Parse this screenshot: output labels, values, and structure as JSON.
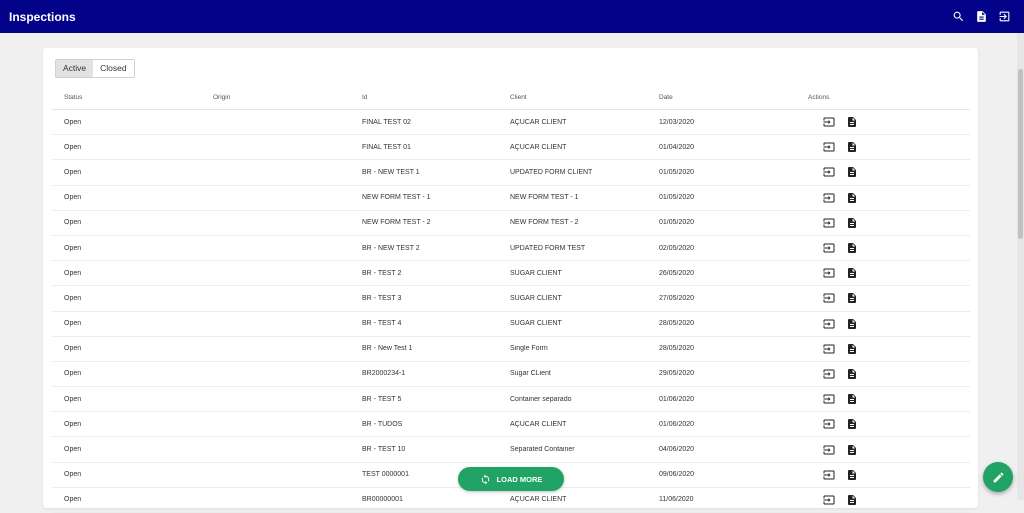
{
  "appbar": {
    "title": "Inspections",
    "icons": [
      "search-icon",
      "document-icon",
      "logout-icon"
    ],
    "color": "#010288"
  },
  "tabs": [
    {
      "label": "Active",
      "selected": true
    },
    {
      "label": "Closed",
      "selected": false
    }
  ],
  "table": {
    "headers": [
      "Status",
      "Origin",
      "Id",
      "Client",
      "Date",
      "Actions"
    ],
    "rows": [
      {
        "status": "Open",
        "origin": "",
        "id": "FINAL TEST 02",
        "client": "AÇUCAR CLIENT",
        "date": "12/03/2020"
      },
      {
        "status": "Open",
        "origin": "",
        "id": "FINAL TEST 01",
        "client": "AÇUCAR CLIENT",
        "date": "01/04/2020"
      },
      {
        "status": "Open",
        "origin": "",
        "id": "BR - NEW TEST 1",
        "client": "UPDATED FORM CLIENT",
        "date": "01/05/2020"
      },
      {
        "status": "Open",
        "origin": "",
        "id": "NEW FORM TEST - 1",
        "client": "NEW FORM TEST - 1",
        "date": "01/05/2020"
      },
      {
        "status": "Open",
        "origin": "",
        "id": "NEW FORM TEST - 2",
        "client": "NEW FORM TEST - 2",
        "date": "01/05/2020"
      },
      {
        "status": "Open",
        "origin": "",
        "id": "BR - NEW TEST 2",
        "client": "UPDATED FORM TEST",
        "date": "02/05/2020"
      },
      {
        "status": "Open",
        "origin": "",
        "id": "BR - TEST 2",
        "client": "SUGAR CLIENT",
        "date": "26/05/2020"
      },
      {
        "status": "Open",
        "origin": "",
        "id": "BR - TEST 3",
        "client": "SUGAR CLIENT",
        "date": "27/05/2020"
      },
      {
        "status": "Open",
        "origin": "",
        "id": "BR - TEST 4",
        "client": "SUGAR CLIENT",
        "date": "28/05/2020"
      },
      {
        "status": "Open",
        "origin": "",
        "id": "BR - New Test 1",
        "client": "Single Form",
        "date": "28/05/2020"
      },
      {
        "status": "Open",
        "origin": "",
        "id": "BR2000234-1",
        "client": "Sugar CLient",
        "date": "29/05/2020"
      },
      {
        "status": "Open",
        "origin": "",
        "id": "BR - TEST 5",
        "client": "Container separado",
        "date": "01/06/2020"
      },
      {
        "status": "Open",
        "origin": "",
        "id": "BR - TUDOS",
        "client": "AÇUCAR CLIENT",
        "date": "01/06/2020"
      },
      {
        "status": "Open",
        "origin": "",
        "id": "BR - TEST 10",
        "client": "Separated Container",
        "date": "04/06/2020"
      },
      {
        "status": "Open",
        "origin": "",
        "id": "TEST 0000001",
        "client": "",
        "date": "09/06/2020"
      },
      {
        "status": "Open",
        "origin": "",
        "id": "BR00000001",
        "client": "AÇUCAR CLIENT",
        "date": "11/06/2020"
      }
    ],
    "row_action_icons": [
      "open-icon",
      "document-icon"
    ]
  },
  "load_more": {
    "label": "LOAD MORE",
    "icon": "refresh-icon",
    "color": "#21a366"
  },
  "fab": {
    "icon": "pencil-icon",
    "color": "#21a366"
  }
}
